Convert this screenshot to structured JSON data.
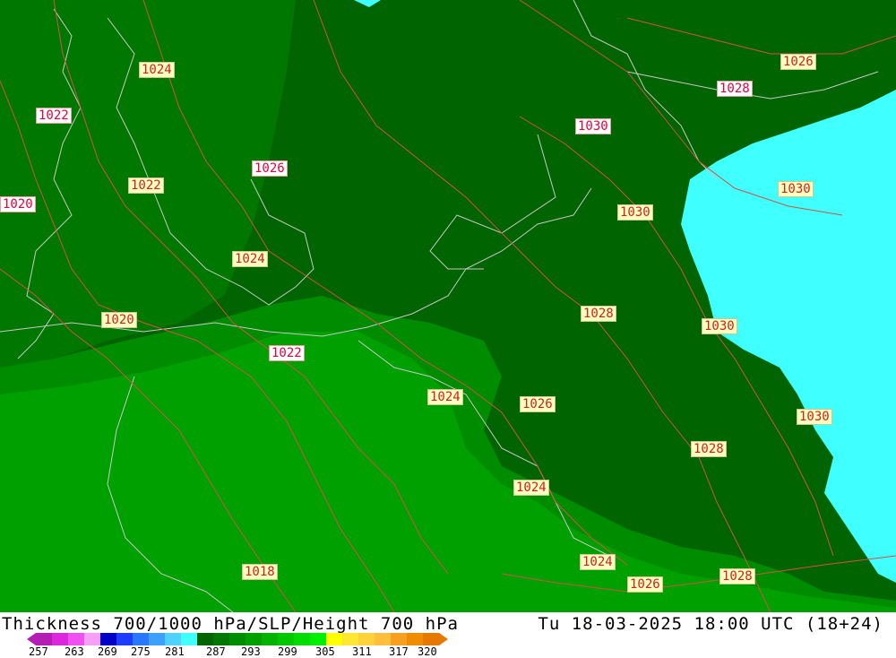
{
  "map": {
    "contour_color": "#d2504a",
    "coast_color": "#c8c8c8",
    "fill_colors": {
      "dark": "#006400",
      "medium": "#007800",
      "light": "#008c00",
      "lighter": "#00a000",
      "cyan": "#40ffff"
    },
    "isobar_labels": [
      {
        "text": "1024",
        "style": "normal"
      },
      {
        "text": "1022",
        "style": "alt"
      },
      {
        "text": "1022",
        "style": "normal"
      },
      {
        "text": "1020",
        "style": "alt"
      },
      {
        "text": "1026",
        "style": "alt"
      },
      {
        "text": "1024",
        "style": "normal"
      },
      {
        "text": "1020",
        "style": "normal"
      },
      {
        "text": "1022",
        "style": "alt"
      },
      {
        "text": "1024",
        "style": "normal"
      },
      {
        "text": "1026",
        "style": "normal"
      },
      {
        "text": "1030",
        "style": "alt"
      },
      {
        "text": "1030",
        "style": "normal"
      },
      {
        "text": "1028",
        "style": "normal"
      },
      {
        "text": "1024",
        "style": "normal"
      },
      {
        "text": "1026",
        "style": "normal"
      },
      {
        "text": "1028",
        "style": "alt"
      },
      {
        "text": "1030",
        "style": "normal"
      },
      {
        "text": "1030",
        "style": "normal"
      },
      {
        "text": "1030",
        "style": "normal"
      },
      {
        "text": "1028",
        "style": "normal"
      },
      {
        "text": "1024",
        "style": "normal"
      },
      {
        "text": "1026",
        "style": "normal"
      },
      {
        "text": "1028",
        "style": "normal"
      },
      {
        "text": "1018",
        "style": "normal"
      }
    ]
  },
  "footer": {
    "title": "Thickness 700/1000 hPa/SLP/Height 700 hPa",
    "valid_time": "Tu 18-03-2025 18:00 UTC (18+24)"
  },
  "legend": {
    "ticks": [
      "257",
      "263",
      "269",
      "275",
      "281",
      "287",
      "293",
      "299",
      "305",
      "311",
      "317",
      "320"
    ],
    "colors": [
      "#b41eb4",
      "#dc28dc",
      "#f050f0",
      "#f5a0f5",
      "#0000c8",
      "#1e3cff",
      "#2878ff",
      "#3ca0ff",
      "#50d2ff",
      "#40ffff",
      "#006400",
      "#007800",
      "#008c00",
      "#00a000",
      "#00b400",
      "#00c800",
      "#00dc00",
      "#00f000",
      "#ffff00",
      "#ffe632",
      "#ffd23c",
      "#ffbe3c",
      "#f5a01e",
      "#f08c00",
      "#e67800"
    ]
  }
}
